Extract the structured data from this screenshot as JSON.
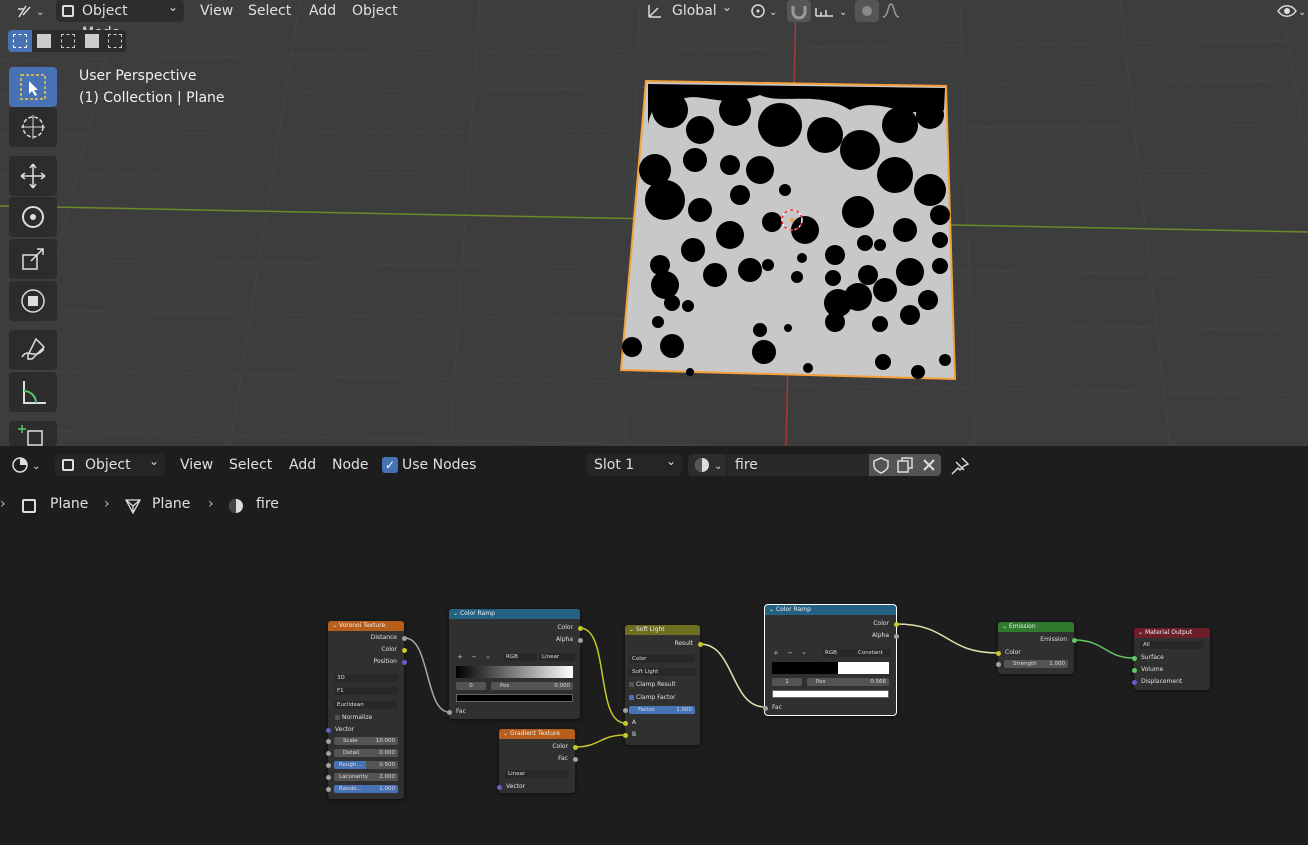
{
  "viewport": {
    "header": {
      "mode": "Object Mode",
      "menus": [
        "View",
        "Select",
        "Add",
        "Object"
      ],
      "orientation": "Global"
    },
    "overlay": {
      "perspective": "User Perspective",
      "collection": "(1) Collection | Plane"
    },
    "tools": [
      "select-box-icon",
      "cursor-icon",
      "move-icon",
      "rotate-icon",
      "scale-icon",
      "transform-icon",
      "annotate-icon",
      "measure-icon",
      "add-cube-icon"
    ]
  },
  "node_editor": {
    "header": {
      "editor_type": "Object",
      "menus": [
        "View",
        "Select",
        "Add",
        "Node"
      ],
      "use_nodes_label": "Use Nodes",
      "use_nodes_checked": true,
      "slot": "Slot 1",
      "material_name": "fire"
    },
    "breadcrumb": [
      "Plane",
      "Plane",
      "fire"
    ],
    "nodes": {
      "voronoi": {
        "title": "Voronoi Texture",
        "outputs": [
          "Distance",
          "Color",
          "Position"
        ],
        "dims": "3D",
        "feature": "F1",
        "metric": "Euclidean",
        "normalize": "Normalize",
        "vector": "Vector",
        "fields": [
          {
            "label": "Scale",
            "value": "10.000"
          },
          {
            "label": "Detail",
            "value": "0.000"
          },
          {
            "label": "Rough...",
            "value": "0.500"
          },
          {
            "label": "Lacunarity",
            "value": "2.000"
          },
          {
            "label": "Rando...",
            "value": "1.000"
          }
        ]
      },
      "ramp1": {
        "title": "Color Ramp",
        "outputs": [
          "Color",
          "Alpha"
        ],
        "mode": "RGB",
        "interp": "Linear",
        "index": "0",
        "pos_label": "Pos",
        "pos": "0.000",
        "input": "Fac"
      },
      "gradient": {
        "title": "Gradient Texture",
        "outputs": [
          "Color",
          "Fac"
        ],
        "type": "Linear",
        "input": "Vector"
      },
      "softlight": {
        "title": "Soft Light",
        "output": "Result",
        "type1": "Color",
        "type2": "Soft Light",
        "clamp_result": "Clamp Result",
        "clamp_factor": "Clamp Factor",
        "factor_label": "Factor",
        "factor": "1.000",
        "a": "A",
        "b": "B"
      },
      "ramp2": {
        "title": "Color Ramp",
        "outputs": [
          "Color",
          "Alpha"
        ],
        "mode": "RGB",
        "interp": "Constant",
        "index": "1",
        "pos_label": "Pos",
        "pos": "0.566",
        "input": "Fac"
      },
      "emission": {
        "title": "Emission",
        "output": "Emission",
        "color": "Color",
        "strength_label": "Strength",
        "strength": "1.000"
      },
      "output": {
        "title": "Material Output",
        "target": "All",
        "inputs": [
          "Surface",
          "Volume",
          "Displacement"
        ]
      }
    }
  },
  "colors": {
    "accent": "#4772b3",
    "selection": "#f5a13a",
    "texture_header": "#b85e1d",
    "converter_header": "#246283",
    "color_header": "#6e6e21",
    "shader_header": "#2f7a2f",
    "output_header": "#6c1e2b",
    "socket_yellow": "#c7c729",
    "socket_gray": "#a1a1a1",
    "socket_purple": "#6363c7",
    "socket_green": "#63c763"
  }
}
